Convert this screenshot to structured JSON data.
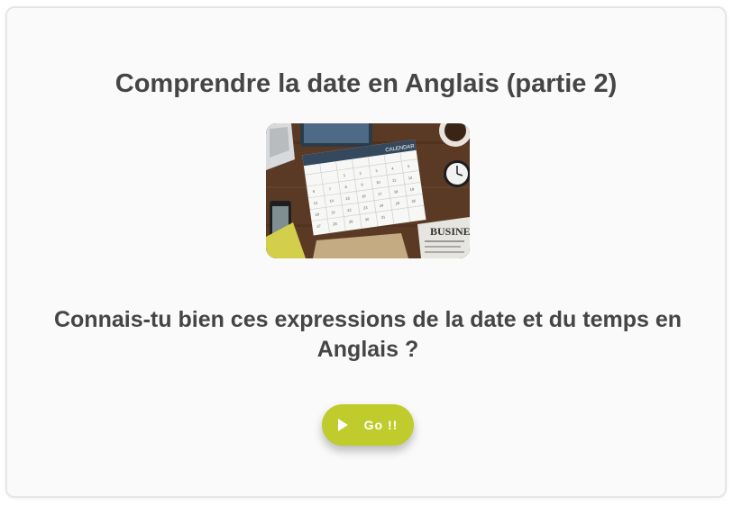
{
  "quiz": {
    "title": "Comprendre la date en Anglais (partie 2)",
    "image_alt": "calendar-on-desk-photo",
    "question": "Connais-tu bien ces expressions de la date et du temps en Anglais ?",
    "go_label": "Go !!",
    "calendar_header": "CALENDAR",
    "newspaper_text": "BUSINE"
  },
  "colors": {
    "accent": "#c0cb2c",
    "text": "#454545",
    "card_bg": "#fafafa"
  }
}
